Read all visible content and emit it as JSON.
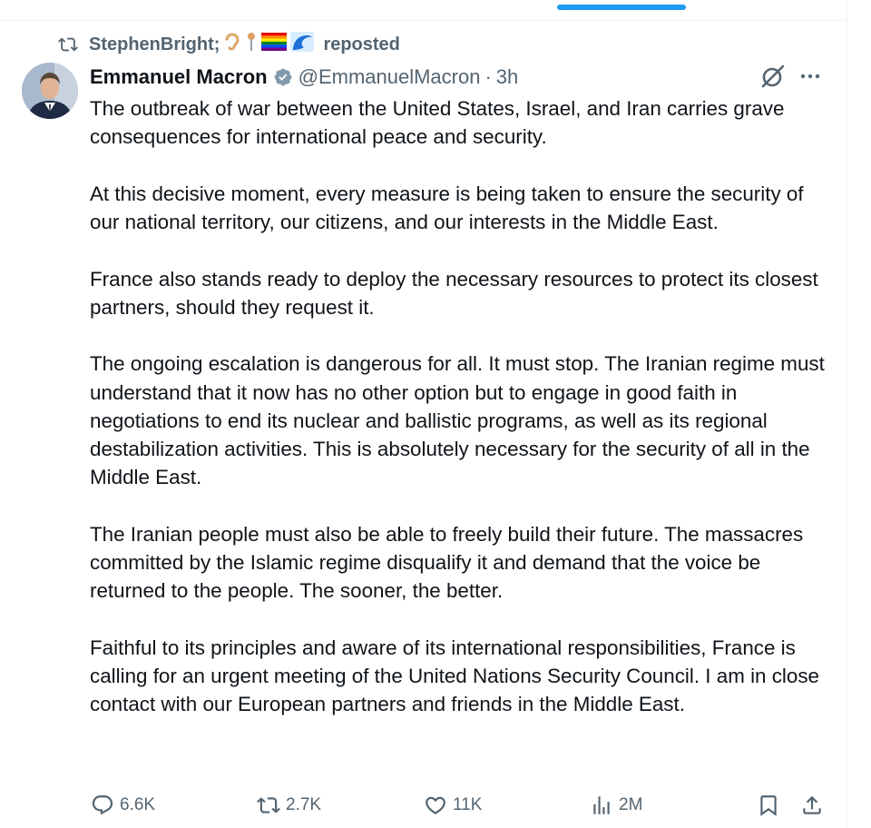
{
  "repost": {
    "user": "StephenBright;",
    "label": "reposted",
    "emojis": [
      "ear-emoji",
      "pin-emoji",
      "rainbow-flag-emoji",
      "water-wave-emoji"
    ]
  },
  "tweet": {
    "author_name": "Emmanuel Macron",
    "handle": "@EmmanuelMacron",
    "separator": "·",
    "time": "3h",
    "paragraphs": [
      "The outbreak of war between the United States, Israel, and Iran carries grave consequences for international peace and security.",
      "At this decisive moment, every measure is being taken to ensure the security of our national territory, our citizens, and our interests in the Middle East.",
      "France also stands ready to deploy the necessary resources to protect its closest partners, should they request it.",
      "The ongoing escalation is dangerous for all. It must stop. The Iranian regime must understand that it now has no other option but to engage in good faith in negotiations to end its nuclear and ballistic programs, as well as its regional destabilization activities. This is absolutely necessary for the security of all in the Middle East.",
      "The Iranian people must also be able to freely build their future. The massacres committed by the Islamic regime disqualify it and demand that the voice be returned to the people. The sooner, the better.",
      "Faithful to its principles and aware of its international responsibilities, France is calling for an urgent meeting of the United Nations Security Council. I am in close contact with our European partners and friends in the Middle East."
    ]
  },
  "actions": {
    "replies": "6.6K",
    "reposts": "2.7K",
    "likes": "11K",
    "views": "2M"
  },
  "colors": {
    "accent": "#1d9bf0",
    "text_primary": "#0f1419",
    "text_secondary": "#536471",
    "border": "#eff3f4"
  }
}
